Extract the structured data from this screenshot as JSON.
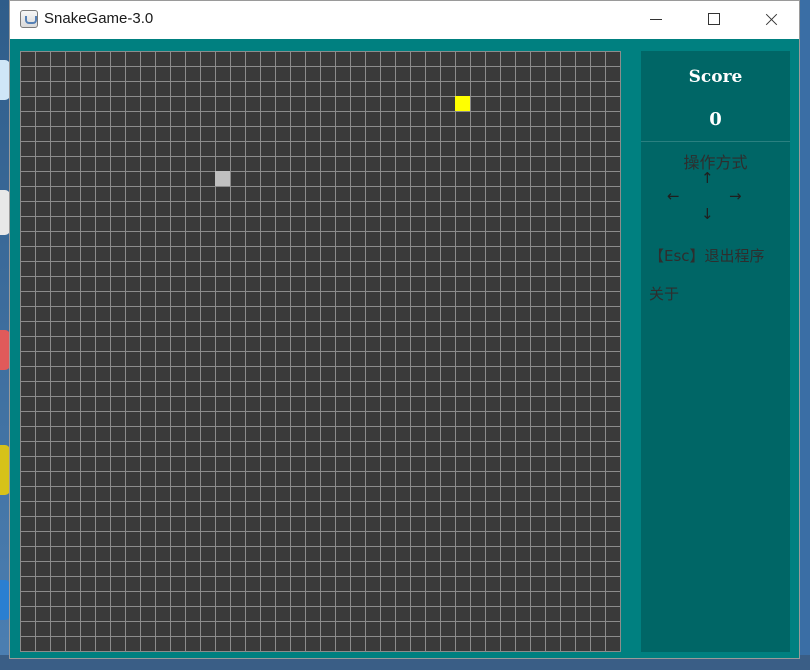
{
  "window": {
    "title": "SnakeGame-3.0"
  },
  "titlebar_buttons": {
    "minimize": "minimize-icon",
    "maximize": "maximize-icon",
    "close": "close-icon"
  },
  "board": {
    "columns": 40,
    "rows": 40,
    "background_color": "#3a3a3a",
    "grid_color": "#8c8c8c",
    "food": {
      "col": 29,
      "row": 3,
      "color": "#ffff00"
    },
    "snake": [
      {
        "col": 13,
        "row": 8,
        "color": "#c0c0c0"
      }
    ]
  },
  "panel": {
    "score_label": "Score",
    "score_value": "0",
    "controls_title": "操作方式",
    "arrows": {
      "up": "↑",
      "left": "←",
      "right": "→",
      "down": "↓"
    },
    "esc_hint": "【Esc】退出程序",
    "about": "关于"
  },
  "colors": {
    "frame": "#008080",
    "panel": "#006666"
  }
}
